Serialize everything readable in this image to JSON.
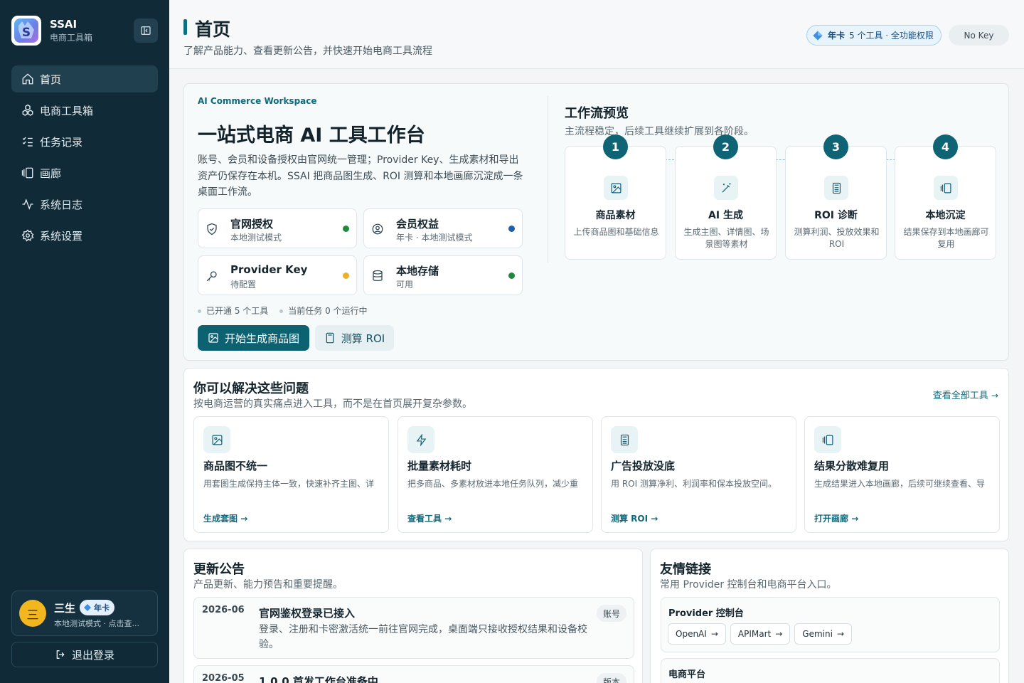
{
  "sidebar": {
    "brand_name": "SSAI",
    "brand_sub": "电商工具箱",
    "nav": [
      {
        "label": "首页"
      },
      {
        "label": "电商工具箱"
      },
      {
        "label": "任务记录"
      },
      {
        "label": "画廊"
      },
      {
        "label": "系统日志"
      },
      {
        "label": "系统设置"
      }
    ],
    "user": {
      "avatar_text": "三",
      "name": "三生",
      "badge": "年卡",
      "sub": "本地测试模式 · 点击查..."
    },
    "logout_label": "退出登录"
  },
  "header": {
    "title": "首页",
    "subtitle": "了解产品能力、查看更新公告，并快速开始电商工具流程",
    "plan_label": "年卡",
    "plan_detail": "5 个工具 · 全功能权限",
    "key_status": "No Key"
  },
  "hero": {
    "eyebrow": "AI Commerce Workspace",
    "title": "一站式电商 AI 工具工作台",
    "description": "账号、会员和设备授权由官网统一管理；Provider Key、生成素材和导出资产仍保存在本机。SSAI 把商品图生成、ROI 测算和本地画廊沉淀成一条桌面工作流。",
    "status": [
      {
        "title": "官网授权",
        "sub": "本地测试模式",
        "color": "#1f8a3c"
      },
      {
        "title": "会员权益",
        "sub": "年卡 · 本地测试模式",
        "color": "#1d5fae"
      },
      {
        "title": "Provider Key",
        "sub": "待配置",
        "color": "#e8b22a"
      },
      {
        "title": "本地存储",
        "sub": "可用",
        "color": "#1f8a3c"
      }
    ],
    "meta": [
      "已开通 5 个工具",
      "当前任务 0 个运行中"
    ],
    "primary_button": "开始生成商品图",
    "secondary_button": "测算 ROI"
  },
  "workflow": {
    "title": "工作流预览",
    "subtitle": "主流程稳定，后续工具继续扩展到各阶段。",
    "steps": [
      {
        "num": "1",
        "title": "商品素材",
        "desc": "上传商品图和基础信息"
      },
      {
        "num": "2",
        "title": "AI 生成",
        "desc": "生成主图、详情图、场景图等素材"
      },
      {
        "num": "3",
        "title": "ROI 诊断",
        "desc": "测算利润、投放效果和 ROI"
      },
      {
        "num": "4",
        "title": "本地沉淀",
        "desc": "结果保存到本地画廊可复用"
      }
    ]
  },
  "problems": {
    "title": "你可以解决这些问题",
    "subtitle": "按电商运营的真实痛点进入工具，而不是在首页展开复杂参数。",
    "see_all": "查看全部工具",
    "items": [
      {
        "title": "商品图不统一",
        "desc": "用套图生成保持主体一致，快速补齐主图、详",
        "link": "生成套图"
      },
      {
        "title": "批量素材耗时",
        "desc": "把多商品、多素材放进本地任务队列，减少重",
        "link": "查看工具"
      },
      {
        "title": "广告投放没底",
        "desc": "用 ROI 测算净利、利润率和保本投放空间。",
        "link": "测算 ROI"
      },
      {
        "title": "结果分散难复用",
        "desc": "生成结果进入本地画廊，后续可继续查看、导",
        "link": "打开画廊"
      }
    ]
  },
  "news": {
    "title": "更新公告",
    "subtitle": "产品更新、能力预告和重要提醒。",
    "items": [
      {
        "date": "2026-06",
        "title": "官网鉴权登录已接入",
        "body": "登录、注册和卡密激活统一前往官网完成，桌面端只接收授权结果和设备校验。",
        "tag": "账号"
      },
      {
        "date": "2026-05",
        "title": "1.0.0 首发工作台准备中",
        "body": "",
        "tag": "版本"
      }
    ]
  },
  "links": {
    "title": "友情链接",
    "subtitle": "常用 Provider 控制台和电商平台入口。",
    "groups": [
      {
        "title": "Provider 控制台",
        "items": [
          "OpenAI",
          "APIMart",
          "Gemini"
        ]
      },
      {
        "title": "电商平台",
        "items": []
      }
    ]
  }
}
